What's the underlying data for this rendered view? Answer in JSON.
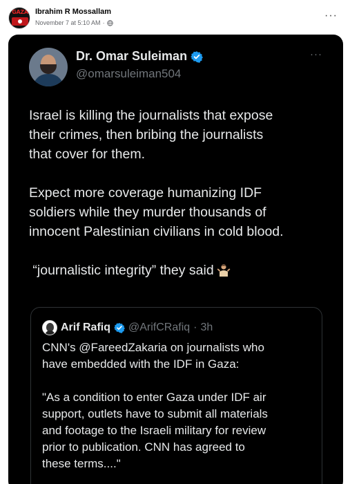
{
  "post": {
    "author": "Ibrahim R Mossallam",
    "avatar_text": "GAZA",
    "timestamp": "November 7 at 5:10 AM",
    "separator": "·",
    "privacy_icon": "globe-icon",
    "more_label": "···"
  },
  "tweet": {
    "name": "Dr. Omar Suleiman",
    "handle": "@omarsuleiman504",
    "more_label": "···",
    "verified_color": "#1d9bf0",
    "paragraph1": [
      "Israel is killing the journalists that expose",
      "their crimes, then bribing the journalists",
      "that cover for them."
    ],
    "paragraph2": [
      "Expect more coverage humanizing IDF",
      "soldiers while they murder thousands of",
      "innocent Palestinian civilians in cold blood."
    ],
    "paragraph3": " “journalistic integrity” they said",
    "emoji": "person-shrugging-emoji"
  },
  "quote": {
    "name": "Arif Rafiq",
    "handle": "@ArifCRafiq",
    "time": "3h",
    "separator": "·",
    "paragraph1": [
      "CNN's @FareedZakaria on journalists who",
      "have embedded with the IDF in Gaza:"
    ],
    "paragraph2": [
      "\"As a condition to enter Gaza under IDF air",
      "support, outlets have to submit all materials",
      "and footage to the Israeli military for review",
      "prior to publication. CNN has agreed to",
      "these terms....\""
    ]
  },
  "colors": {
    "card_bg": "#000000",
    "text": "#e7e9ea",
    "muted": "#71767b",
    "verified": "#1d9bf0"
  }
}
